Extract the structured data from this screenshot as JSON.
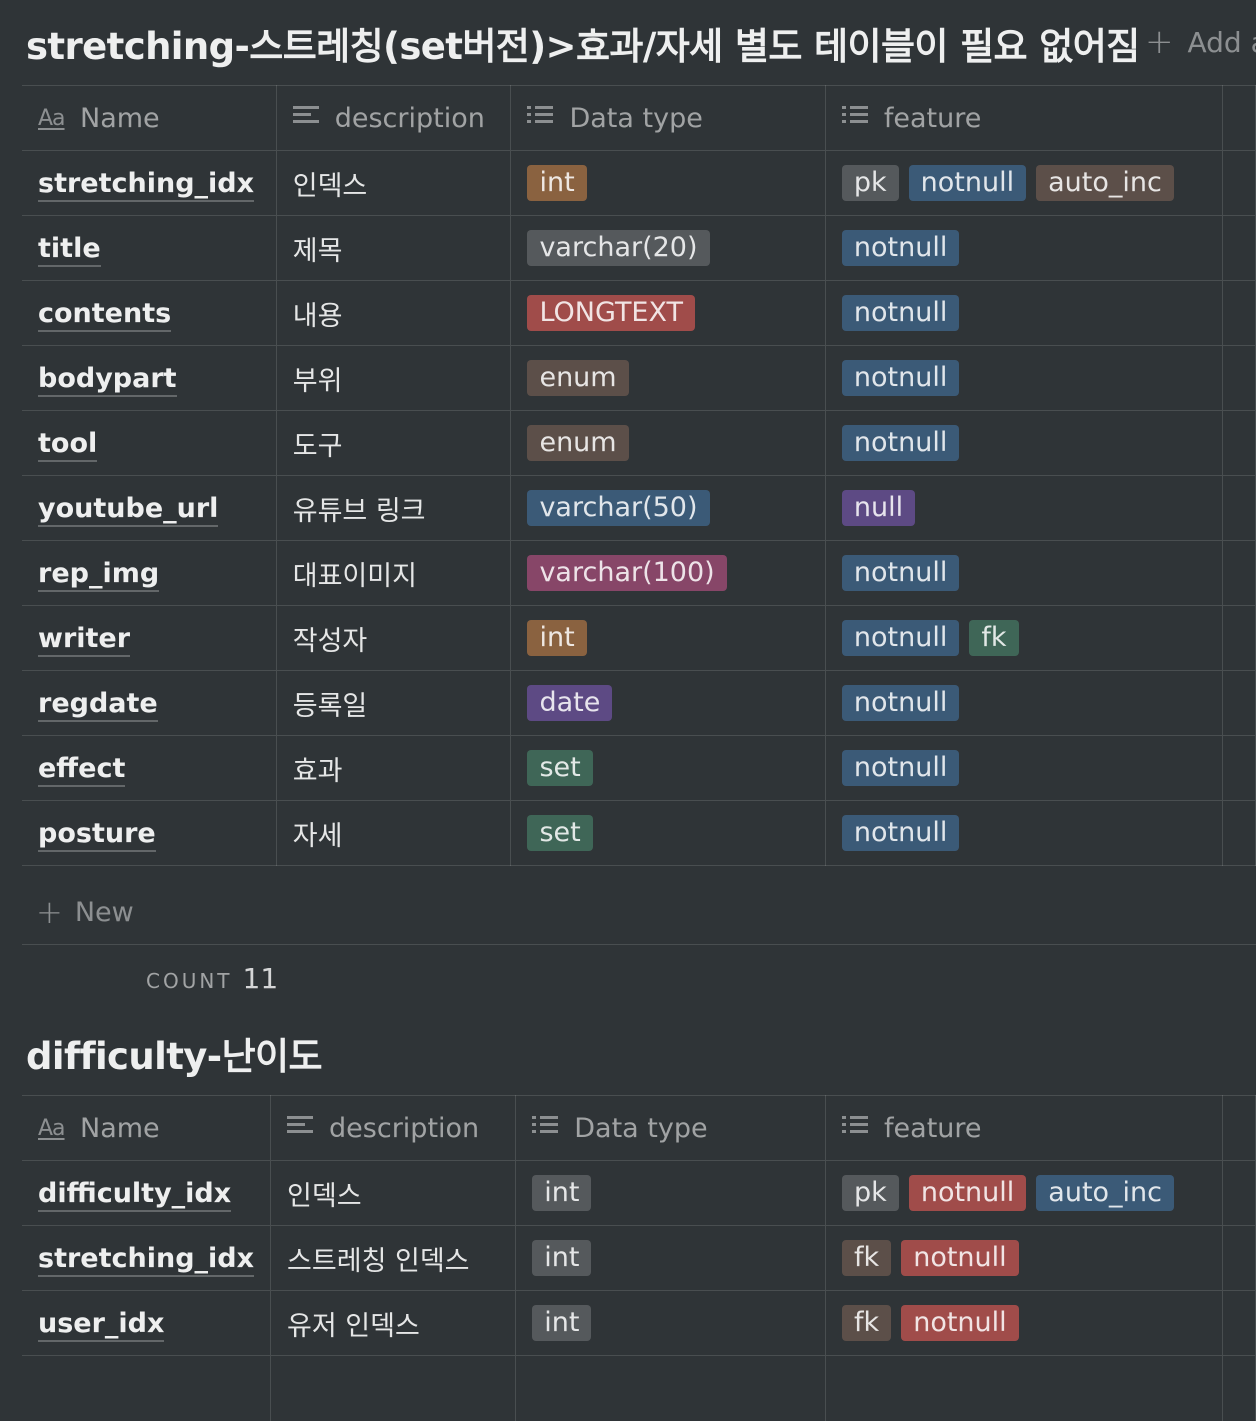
{
  "tables": [
    {
      "title": "stretching-스트레칭(set버전)>효과/자세 별도 테이블이 필요 없어짐",
      "add_view": "Add a view",
      "headers": [
        "Name",
        "description",
        "Data type",
        "feature"
      ],
      "rows": [
        {
          "name": "stretching_idx",
          "description": "인덱스",
          "type": {
            "label": "int",
            "color": "#8a6240"
          },
          "features": [
            {
              "label": "pk",
              "color": "#55595c"
            },
            {
              "label": "notnull",
              "color": "#3b5a77"
            },
            {
              "label": "auto_inc",
              "color": "#5c4f49"
            }
          ]
        },
        {
          "name": "title",
          "description": "제목",
          "type": {
            "label": "varchar(20)",
            "color": "#55595c"
          },
          "features": [
            {
              "label": "notnull",
              "color": "#3b5a77"
            }
          ]
        },
        {
          "name": "contents",
          "description": "내용",
          "type": {
            "label": "LONGTEXT",
            "color": "#a04c4a"
          },
          "features": [
            {
              "label": "notnull",
              "color": "#3b5a77"
            }
          ]
        },
        {
          "name": "bodypart",
          "description": "부위",
          "type": {
            "label": "enum",
            "color": "#5c4f49"
          },
          "features": [
            {
              "label": "notnull",
              "color": "#3b5a77"
            }
          ]
        },
        {
          "name": "tool",
          "description": "도구",
          "type": {
            "label": "enum",
            "color": "#5c4f49"
          },
          "features": [
            {
              "label": "notnull",
              "color": "#3b5a77"
            }
          ]
        },
        {
          "name": "youtube_url",
          "description": "유튜브 링크",
          "type": {
            "label": "varchar(50)",
            "color": "#3b5a77"
          },
          "features": [
            {
              "label": "null",
              "color": "#5d4a84"
            }
          ]
        },
        {
          "name": "rep_img",
          "description": "대표이미지",
          "type": {
            "label": "varchar(100)",
            "color": "#874668"
          },
          "features": [
            {
              "label": "notnull",
              "color": "#3b5a77"
            }
          ]
        },
        {
          "name": "writer",
          "description": "작성자",
          "type": {
            "label": "int",
            "color": "#8a6240"
          },
          "features": [
            {
              "label": "notnull",
              "color": "#3b5a77"
            },
            {
              "label": "fk",
              "color": "#3f6657"
            }
          ]
        },
        {
          "name": "regdate",
          "description": "등록일",
          "type": {
            "label": "date",
            "color": "#5d4a84"
          },
          "features": [
            {
              "label": "notnull",
              "color": "#3b5a77"
            }
          ]
        },
        {
          "name": "effect",
          "description": "효과",
          "type": {
            "label": "set",
            "color": "#3f6657"
          },
          "features": [
            {
              "label": "notnull",
              "color": "#3b5a77"
            }
          ]
        },
        {
          "name": "posture",
          "description": "자세",
          "type": {
            "label": "set",
            "color": "#3f6657"
          },
          "features": [
            {
              "label": "notnull",
              "color": "#3b5a77"
            }
          ]
        }
      ],
      "new_label": "New",
      "count_label": "COUNT",
      "count_value": "11"
    },
    {
      "title": "difficulty-난이도",
      "headers": [
        "Name",
        "description",
        "Data type",
        "feature"
      ],
      "rows": [
        {
          "name": "difficulty_idx",
          "description": "인덱스",
          "type": {
            "label": "int",
            "color": "#55595c"
          },
          "features": [
            {
              "label": "pk",
              "color": "#55595c"
            },
            {
              "label": "notnull",
              "color": "#a04c4a"
            },
            {
              "label": "auto_inc",
              "color": "#3b5a77"
            }
          ]
        },
        {
          "name": "stretching_idx",
          "description": "스트레칭 인덱스",
          "type": {
            "label": "int",
            "color": "#55595c"
          },
          "features": [
            {
              "label": "fk",
              "color": "#5c4f49"
            },
            {
              "label": "notnull",
              "color": "#a04c4a"
            }
          ]
        },
        {
          "name": "user_idx",
          "description": "유저 인덱스",
          "type": {
            "label": "int",
            "color": "#55595c"
          },
          "features": [
            {
              "label": "fk",
              "color": "#5c4f49"
            },
            {
              "label": "notnull",
              "color": "#a04c4a"
            }
          ]
        },
        {
          "name": "",
          "description": "",
          "type": null,
          "features": []
        }
      ]
    }
  ]
}
